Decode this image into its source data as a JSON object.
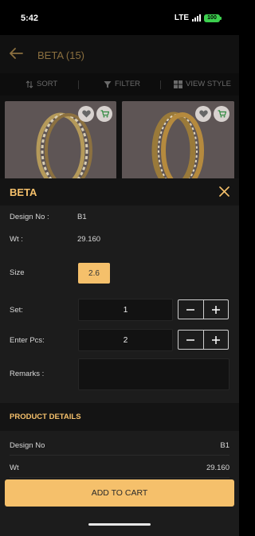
{
  "status_bar": {
    "time": "5:42",
    "network": "LTE",
    "battery": "100"
  },
  "header": {
    "title": "BETA (15)",
    "back_icon": "arrow-left-icon"
  },
  "toolbar": {
    "sort_label": "SORT",
    "filter_label": "FILTER",
    "view_style_label": "VIEW STYLE"
  },
  "products": [
    {
      "name": "bangle-product-1",
      "favorite_icon": "heart-icon",
      "cart_icon": "cart-icon"
    },
    {
      "name": "bangle-product-2",
      "favorite_icon": "heart-icon",
      "cart_icon": "cart-icon"
    }
  ],
  "sheet": {
    "title": "BETA",
    "design_no_label": "Design No :",
    "design_no_value": "B1",
    "wt_label": "Wt :",
    "wt_value": "29.160",
    "size_label": "Size",
    "size_value": "2.6",
    "set_label": "Set:",
    "set_value": "1",
    "pcs_label": "Enter Pcs:",
    "pcs_value": "2",
    "remarks_label": "Remarks :",
    "remarks_value": ""
  },
  "product_details": {
    "title": "PRODUCT DETAILS",
    "rows": [
      {
        "key": "Design No",
        "value": "B1"
      },
      {
        "key": "Wt",
        "value": "29.160"
      }
    ]
  },
  "add_to_cart_label": "ADD TO CART",
  "colors": {
    "accent": "#f5c06b",
    "background": "#1c1c1c",
    "header_title": "#8a6f3f"
  }
}
